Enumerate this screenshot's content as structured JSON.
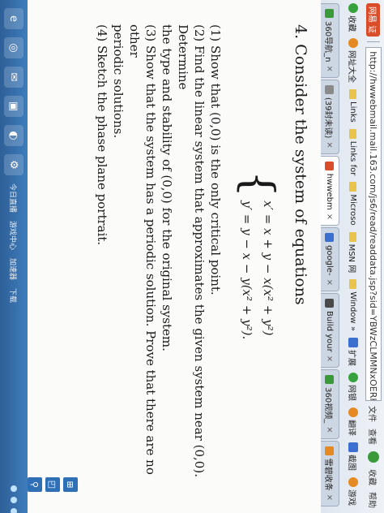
{
  "browser": {
    "site_badge": "网易 证",
    "url": "http://hwwebmail.mail.163.com/js6/read/readdata.jsp?sid=YBWzCLMMNxOERHSjMMyfmaFnkSJSR&mid=",
    "tools": [
      "文件",
      "查看",
      "收藏",
      "帮助"
    ],
    "favorites": [
      {
        "label": "收藏",
        "icon": "star-icon"
      },
      {
        "label": "网址大全",
        "icon": "globe-icon"
      },
      {
        "label": "Links",
        "icon": "folder-icon"
      },
      {
        "label": "Links for",
        "icon": "folder-icon"
      },
      {
        "label": "Microso",
        "icon": "folder-icon"
      },
      {
        "label": "MSN 网",
        "icon": "folder-icon"
      },
      {
        "label": "Window »",
        "icon": "folder-icon"
      },
      {
        "label": "扩展",
        "icon": "extension-icon"
      },
      {
        "label": "网银",
        "icon": "bank-icon"
      },
      {
        "label": "翻译",
        "icon": "translate-icon"
      },
      {
        "label": "截图",
        "icon": "screenshot-icon"
      },
      {
        "label": "游戏",
        "icon": "game-icon"
      }
    ],
    "tabs": [
      {
        "label": "360导航_n",
        "color": "#3a9a3a"
      },
      {
        "label": "(39封未读)",
        "color": "#8a8a8a"
      },
      {
        "label": "hwwebm",
        "color": "#d94d2a",
        "active": true
      },
      {
        "label": "google-",
        "color": "#3b6fd0"
      },
      {
        "label": "Build your",
        "color": "#4a4a4a"
      },
      {
        "label": "360视频_",
        "color": "#3a9a3a"
      },
      {
        "label": "雪碧收条",
        "color": "#e58a22"
      }
    ]
  },
  "content": {
    "heading": "4. Consider the system of equations",
    "equations": [
      "x′ = x + y − x(x² + y²)",
      "y′ = y − x − y(x² + y²)."
    ],
    "parts": [
      {
        "text": "(1) Show that (0,0) is the only critical point."
      },
      {
        "text": "(2) Find the linear system that approximates the given system near (0,0). Determine"
      },
      {
        "text": "the type and stability of (0,0) for the original system."
      },
      {
        "text": "(3) Show that the system has a periodic solution.  Prove that there are no other"
      },
      {
        "text": "periodic solutions."
      },
      {
        "text": "(4) Sketch the phase plane portrait."
      }
    ]
  },
  "reader_tools": [
    "⊞",
    "◰",
    "⚲",
    "⚲",
    "▦"
  ],
  "taskbar": {
    "apps": [
      "e",
      "◎",
      "✉",
      "▣",
      "◐",
      "⚙"
    ],
    "items": [
      "今日直播",
      "游戏中心",
      "加速器",
      "下载"
    ]
  }
}
